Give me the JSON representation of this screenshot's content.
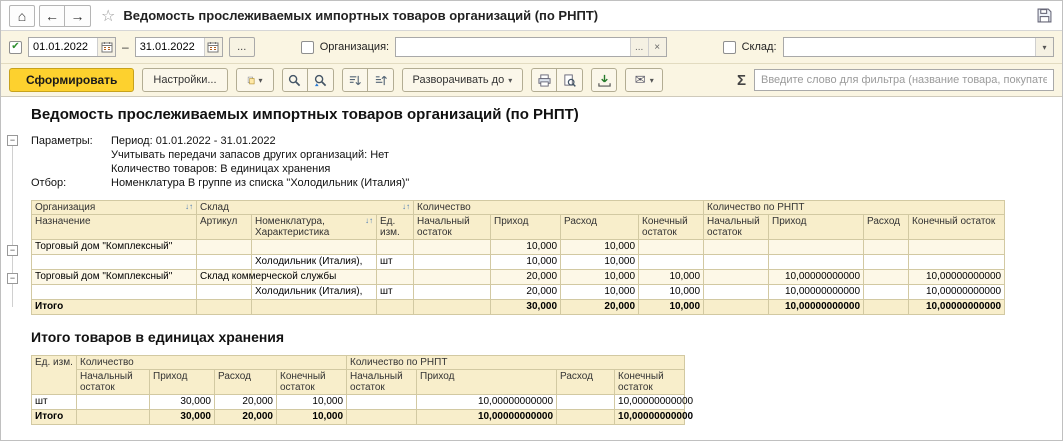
{
  "icons": {
    "home": "⌂",
    "back": "←",
    "forward": "→",
    "star": "☆",
    "check": "✔",
    "dropdown": "▾",
    "ellipsis": "...",
    "clear": "×",
    "dash": "–",
    "envelope": "✉",
    "sigma": "Σ",
    "sort": "↓↑",
    "collapse": "−"
  },
  "titlebar": {
    "title": "Ведомость прослеживаемых импортных товаров организаций (по РНПТ)"
  },
  "filter_panel": {
    "period_enabled": "checked",
    "date_from": "01.01.2022",
    "date_to": "31.01.2022",
    "organization_label": "Организация:",
    "organization_value": "",
    "warehouse_label": "Склад:",
    "warehouse_value": ""
  },
  "toolbar": {
    "generate": "Сформировать",
    "settings": "Настройки...",
    "expand_to": "Разворачивать до",
    "filter_placeholder": "Введите слово для фильтра (название товара, покупателя и..."
  },
  "report": {
    "title": "Ведомость прослеживаемых импортных товаров организаций (по РНПТ)",
    "params_label": "Параметры:",
    "param_lines": [
      "Период: 01.01.2022 - 31.01.2022",
      "Учитывать передачи запасов других организаций: Нет",
      "Количество товаров: В единицах хранения"
    ],
    "selection_label": "Отбор:",
    "selection_value": "Номенклатура В группе из списка \"Холодильник (Италия)\""
  },
  "main_table": {
    "h_org": "Организация",
    "h_wh": "Склад",
    "h_qty": "Количество",
    "h_qty_rnpt": "Количество по РНПТ",
    "h2": [
      "Назначение",
      "Артикул",
      "Номенклатура, Характеристика",
      "Ед. изм.",
      "Начальный остаток",
      "Приход",
      "Расход",
      "Конечный остаток",
      "Начальный остаток",
      "Приход",
      "Расход",
      "Конечный остаток"
    ],
    "rows": [
      [
        "Торговый дом \"Комплексный\"",
        "",
        "",
        "",
        "",
        "10,000",
        "10,000",
        "",
        "",
        "",
        "",
        ""
      ],
      [
        "",
        "",
        "Холодильник (Италия),",
        "шт",
        "",
        "10,000",
        "10,000",
        "",
        "",
        "",
        "",
        ""
      ],
      [
        "Торговый дом \"Комплексный\"",
        "Склад коммерческой службы",
        "",
        "",
        "",
        "20,000",
        "10,000",
        "10,000",
        "",
        "10,00000000000",
        "",
        "10,00000000000"
      ],
      [
        "",
        "",
        "Холодильник (Италия),",
        "шт",
        "",
        "20,000",
        "10,000",
        "10,000",
        "",
        "10,00000000000",
        "",
        "10,00000000000"
      ],
      [
        "Итого",
        "",
        "",
        "",
        "",
        "30,000",
        "20,000",
        "10,000",
        "",
        "10,00000000000",
        "",
        "10,00000000000"
      ]
    ]
  },
  "summary_table": {
    "title": "Итого товаров в единицах хранения",
    "h_unit": "Ед. изм.",
    "h_qty": "Количество",
    "h_qty_rnpt": "Количество по РНПТ",
    "h2": [
      "Начальный остаток",
      "Приход",
      "Расход",
      "Конечный остаток",
      "Начальный остаток",
      "Приход",
      "Расход",
      "Конечный остаток"
    ],
    "rows": [
      [
        "шт",
        "",
        "30,000",
        "20,000",
        "10,000",
        "",
        "10,00000000000",
        "",
        "10,00000000000"
      ],
      [
        "Итого",
        "",
        "30,000",
        "20,000",
        "10,000",
        "",
        "10,00000000000",
        "",
        "10,00000000000"
      ]
    ]
  }
}
